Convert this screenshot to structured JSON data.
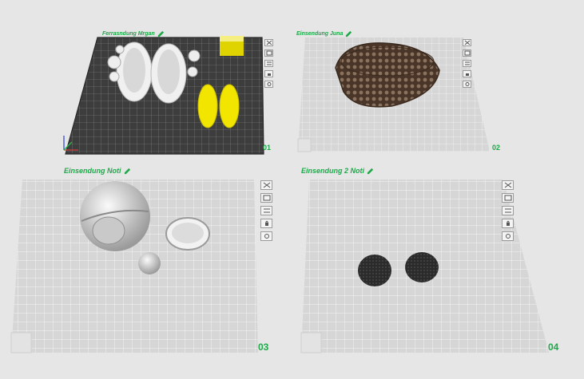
{
  "plates": [
    {
      "title": "Ferrasndung Mrgan",
      "number": "01"
    },
    {
      "title": "Einsendung Juna",
      "number": "02"
    },
    {
      "title": "Einsendung Noti",
      "number": "03"
    },
    {
      "title": "Einsendung 2 Noti",
      "number": "04"
    }
  ],
  "toolbar_icons": [
    "close-icon",
    "arrange-icon",
    "orient-icon",
    "lock-icon",
    "settings-icon"
  ],
  "colors": {
    "accent_green": "#1fa84a",
    "active_plate": "#3a3a3a",
    "inactive_plate": "#d9d9d9",
    "filament_yellow": "#f2e600",
    "basket_brown": "#5b4636"
  }
}
